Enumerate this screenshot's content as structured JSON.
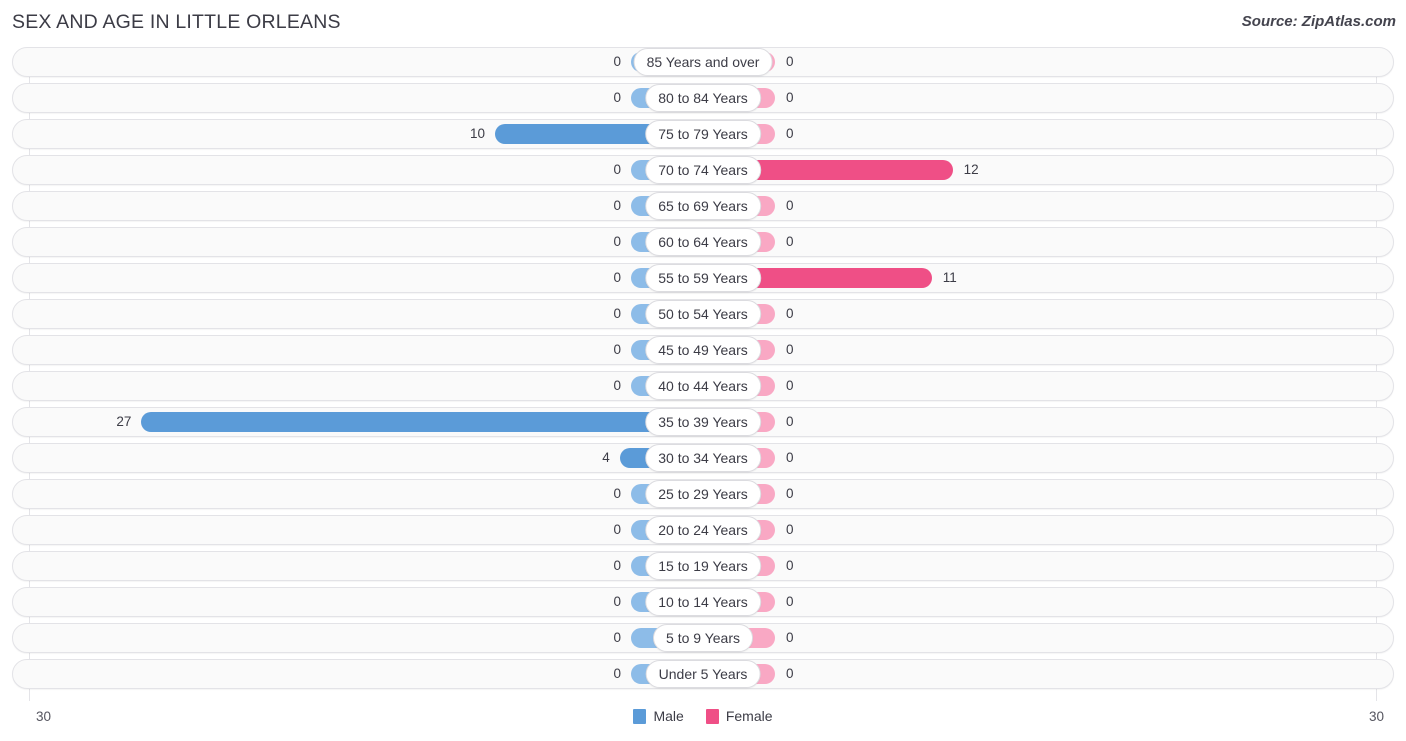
{
  "header": {
    "title": "SEX AND AGE IN LITTLE ORLEANS",
    "source": "Source: ZipAtlas.com"
  },
  "legend": {
    "male_label": "Male",
    "female_label": "Female",
    "male_color": "#5b9bd8",
    "female_color": "#ef4f86"
  },
  "axis": {
    "left_tick": "30",
    "right_tick": "30",
    "max": 30
  },
  "colors": {
    "male_zero": "#8dbce8",
    "male_nonzero": "#5b9bd8",
    "female_zero": "#f9a8c4",
    "female_nonzero": "#ef4f86",
    "track_background": "#fafafa",
    "track_border": "#e3e3e7",
    "gridline": "#e4e4e8",
    "text": "#3c3c46"
  },
  "chart_data": {
    "type": "bar",
    "subtype": "population-pyramid",
    "title": "SEX AND AGE IN LITTLE ORLEANS",
    "xlabel": "",
    "ylabel": "",
    "xlim": [
      -30,
      30
    ],
    "grid": true,
    "legend_position": "bottom-center",
    "categories": [
      "85 Years and over",
      "80 to 84 Years",
      "75 to 79 Years",
      "70 to 74 Years",
      "65 to 69 Years",
      "60 to 64 Years",
      "55 to 59 Years",
      "50 to 54 Years",
      "45 to 49 Years",
      "40 to 44 Years",
      "35 to 39 Years",
      "30 to 34 Years",
      "25 to 29 Years",
      "20 to 24 Years",
      "15 to 19 Years",
      "10 to 14 Years",
      "5 to 9 Years",
      "Under 5 Years"
    ],
    "series": [
      {
        "name": "Male",
        "color": "#5b9bd8",
        "direction": "left",
        "values": [
          0,
          0,
          10,
          0,
          0,
          0,
          0,
          0,
          0,
          0,
          27,
          4,
          0,
          0,
          0,
          0,
          0,
          0
        ]
      },
      {
        "name": "Female",
        "color": "#ef4f86",
        "direction": "right",
        "values": [
          0,
          0,
          0,
          12,
          0,
          0,
          11,
          0,
          0,
          0,
          0,
          0,
          0,
          0,
          0,
          0,
          0,
          0
        ]
      }
    ]
  }
}
